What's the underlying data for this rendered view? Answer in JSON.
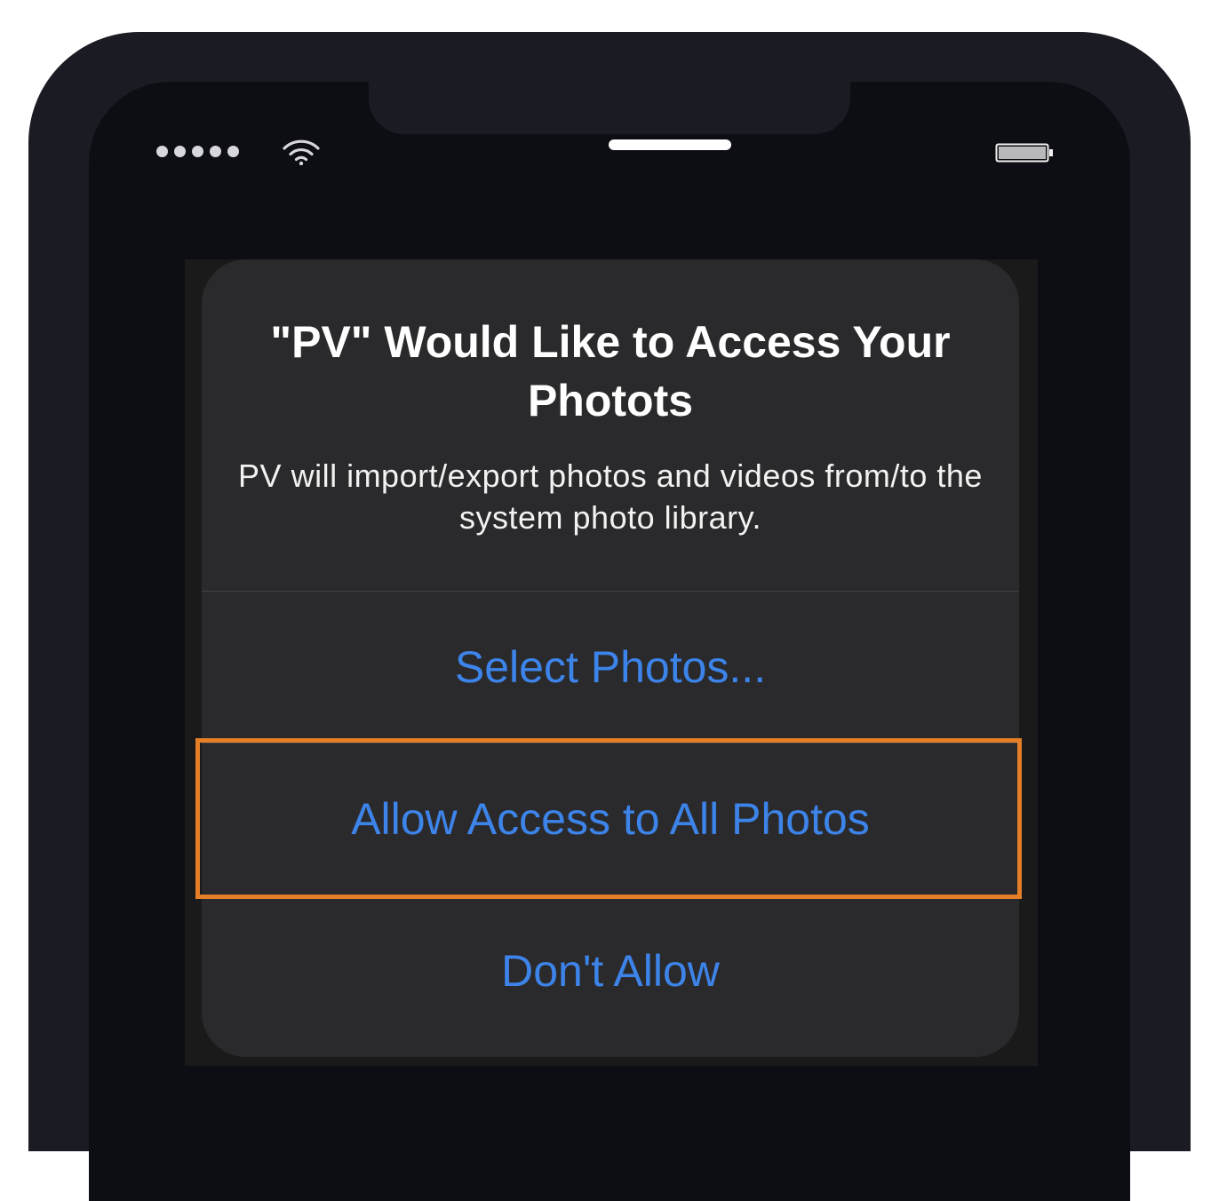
{
  "status_bar": {
    "signal_icon": "signal-dots-icon",
    "wifi_icon": "wifi-icon",
    "battery_icon": "battery-icon",
    "signal_dots": 5
  },
  "alert": {
    "title": "\"PV\" Would Like to Access Your Photots",
    "message": "PV will import/export photos and videos from/to the system photo library.",
    "buttons": {
      "select_photos": "Select Photos...",
      "allow_all": "Allow Access to All Photos",
      "dont_allow": "Don't Allow"
    }
  },
  "colors": {
    "button_text": "#3d84ea",
    "highlight_border": "#e47f27",
    "alert_background": "#2a2a2c",
    "device_frame": "#1b1b23"
  }
}
